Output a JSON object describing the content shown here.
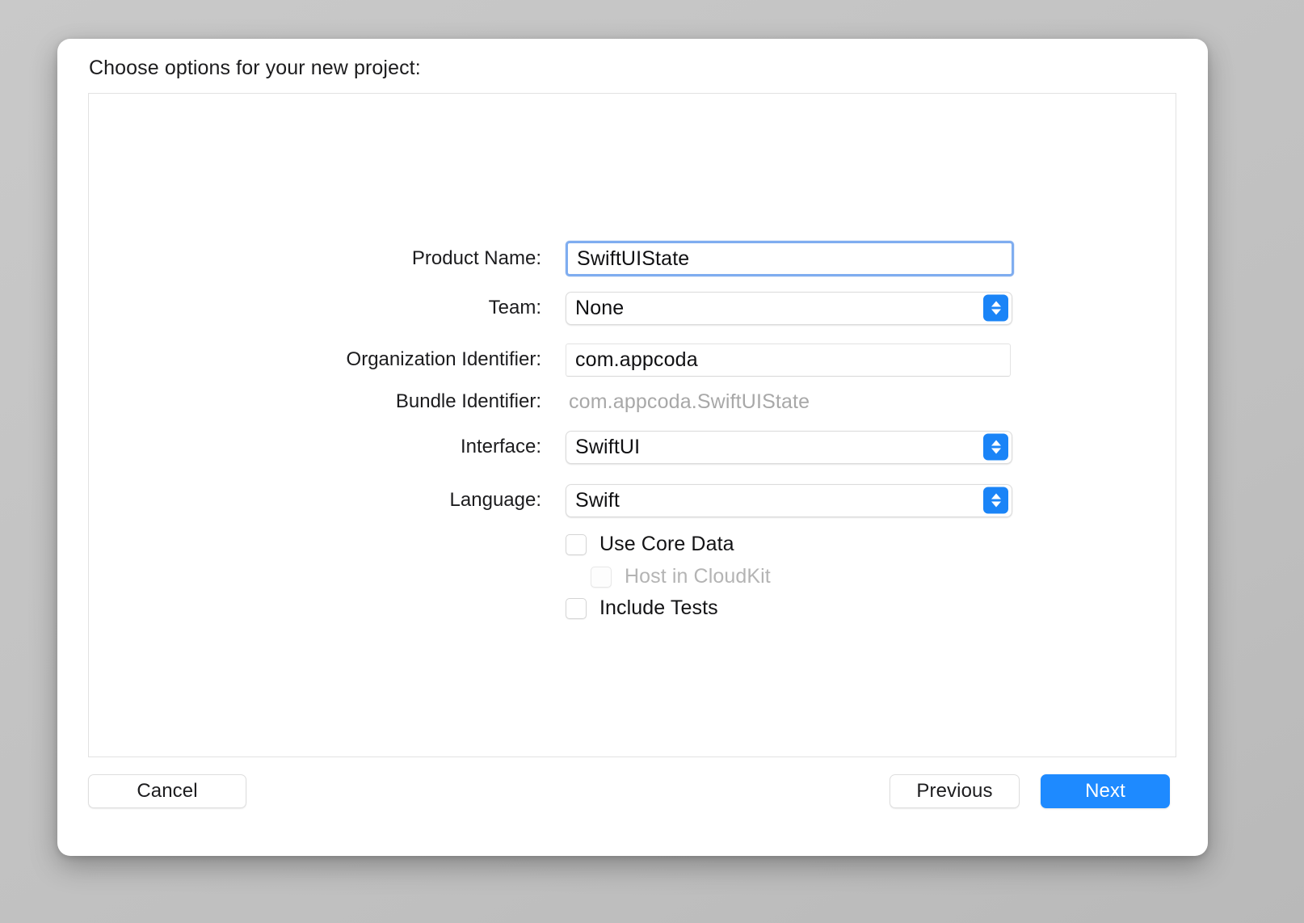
{
  "dialog": {
    "title": "Choose options for your new project:"
  },
  "form": {
    "fields": [
      {
        "label": "Product Name:",
        "type": "textfield-focused",
        "value": "SwiftUIState",
        "name": "product-name"
      },
      {
        "label": "Team:",
        "type": "popup",
        "value": "None",
        "name": "team"
      },
      {
        "label": "Organization Identifier:",
        "type": "textfield",
        "value": "com.appcoda",
        "name": "organization-identifier"
      },
      {
        "label": "Bundle Identifier:",
        "type": "static",
        "value": "com.appcoda.SwiftUIState",
        "name": "bundle-identifier"
      },
      {
        "label": "Interface:",
        "type": "popup",
        "value": "SwiftUI",
        "name": "interface"
      },
      {
        "label": "Language:",
        "type": "popup",
        "value": "Swift",
        "name": "language"
      }
    ],
    "checkboxes": [
      {
        "label": "Use Core Data",
        "checked": false,
        "disabled": false,
        "indent": false,
        "name": "use-core-data"
      },
      {
        "label": "Host in CloudKit",
        "checked": false,
        "disabled": true,
        "indent": true,
        "name": "host-in-cloudkit"
      },
      {
        "label": "Include Tests",
        "checked": false,
        "disabled": false,
        "indent": false,
        "name": "include-tests"
      }
    ]
  },
  "footer": {
    "cancel_label": "Cancel",
    "previous_label": "Previous",
    "next_label": "Next"
  },
  "icons": {
    "popup_arrows": "chevron-up-down-icon"
  },
  "colors": {
    "accent": "#1e8aff",
    "focus_ring": "#7fadf0",
    "stepper_blue": "#1a84f7",
    "disabled_text": "#b4b4b4",
    "static_text": "#a8a8a8",
    "panel_border": "#e2e2e2",
    "desktop_background": "#c4c4c4"
  }
}
